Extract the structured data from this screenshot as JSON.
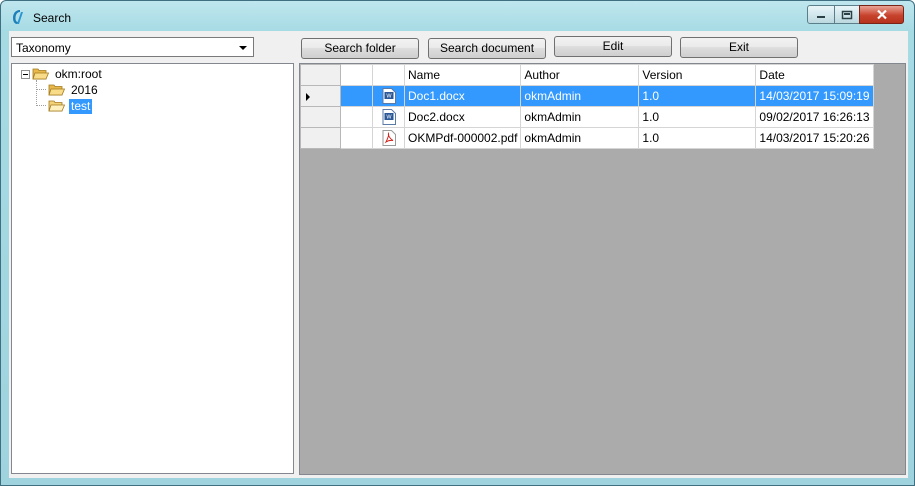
{
  "window": {
    "title": "Search",
    "controls": {
      "minimize": "minimize",
      "maximize": "maximize",
      "close": "close"
    }
  },
  "toolbar": {
    "combo_value": "Taxonomy",
    "search_folder_label": "Search folder",
    "search_document_label": "Search document",
    "edit_label": "Edit",
    "exit_label": "Exit"
  },
  "tree": {
    "root": {
      "label": "okm:root",
      "expanded": true
    },
    "children": [
      {
        "label": "2016",
        "selected": false
      },
      {
        "label": "test",
        "selected": true
      }
    ]
  },
  "grid": {
    "columns": [
      "",
      "",
      "Name",
      "Author",
      "Version",
      "Date"
    ],
    "rows": [
      {
        "icon": "word-doc-icon",
        "name": "Doc1.docx",
        "author": "okmAdmin",
        "version": "1.0",
        "date": "14/03/2017 15:09:19",
        "selected": true
      },
      {
        "icon": "word-doc-icon",
        "name": "Doc2.docx",
        "author": "okmAdmin",
        "version": "1.0",
        "date": "09/02/2017 16:26:13",
        "selected": false
      },
      {
        "icon": "pdf-icon",
        "name": "OKMPdf-000002.pdf",
        "author": "okmAdmin",
        "version": "1.0",
        "date": "14/03/2017 15:20:26",
        "selected": false
      }
    ]
  },
  "colors": {
    "selection": "#3399ff",
    "grid_empty": "#ababab",
    "window_frame": "#a7dbe4"
  }
}
